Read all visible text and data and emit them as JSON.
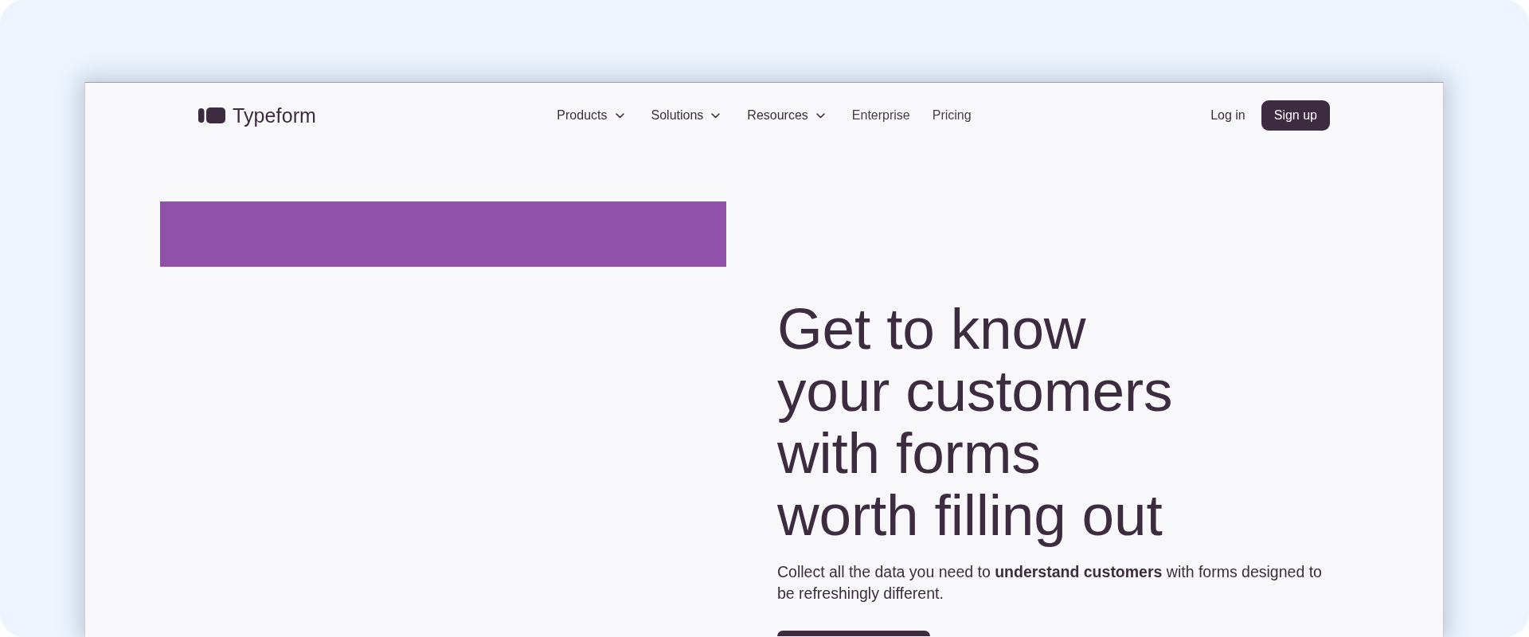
{
  "nav": {
    "logo": {
      "text": "Typeform"
    },
    "items": [
      {
        "label": "Products",
        "kind": "menu"
      },
      {
        "label": "Solutions",
        "kind": "menu"
      },
      {
        "label": "Resources",
        "kind": "menu"
      },
      {
        "label": "Enterprise",
        "kind": "link"
      },
      {
        "label": "Pricing",
        "kind": "link"
      }
    ],
    "login": "Log in",
    "signup": "Sign up"
  },
  "hero": {
    "heading": "Get to know\nyour customers\nwith forms\nworth filling out",
    "text": "Collect all the data you need to **understand customers** with forms designed to be refreshingly different."
  }
}
